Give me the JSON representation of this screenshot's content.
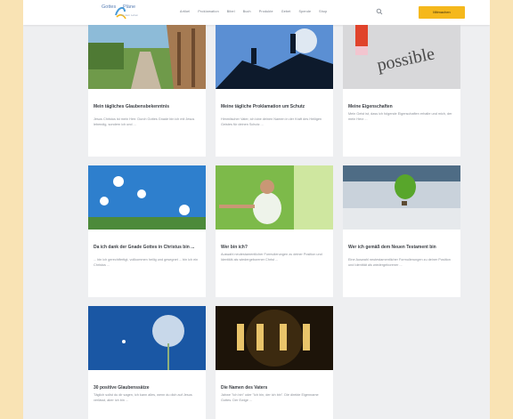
{
  "header": {
    "logo_word1": "Gottes",
    "logo_word2": "Pläne",
    "logo_tagline": "für dein Leben",
    "nav": [
      "Artikel",
      "Proklamation",
      "Bibel",
      "Buch",
      "Produkte",
      "Gebet",
      "Spende",
      "Shop"
    ],
    "cta_label": "Mitmachen",
    "colors": {
      "accent": "#f5b81c",
      "logo": "#5a7fb4"
    }
  },
  "cards": [
    {
      "title": "Mein tägliches Glaubensbekenntnis",
      "excerpt": "Jesus Christus ist mein Herr. Durch Gottes Gnade bin ich mit Jesus lebendig, sondern ich und ..."
    },
    {
      "title": "Meine tägliche Proklamation um Schutz",
      "excerpt": "Himmlischer Vater, ich lobe deinen Namen in der Kraft des Heiligen Geistes für deinen Schutz ..."
    },
    {
      "title": "Meine Eigenschaften",
      "excerpt": "Mein Geist ist, dass ich folgende Eigenschaften erhalte und mich, der mein Herz ..."
    },
    {
      "title": "Da ich dank der Gnade Gottes in Christus bin ...",
      "excerpt": "... bin ich gerechtfertigt, vollkommen heilig und gesegnet ... bin ich ein Christus ..."
    },
    {
      "title": "Wer bin ich?",
      "excerpt": "Auswahl neutestamentlicher Formulierungen zu deiner Position und Identität als wiedergeborener Christ ..."
    },
    {
      "title": "Wer ich gemäß dem Neuen Testament bin",
      "excerpt": "Eine Auswahl neutestamentlicher Formulierungen zu deiner Position und Identität als wiedergeborener ..."
    },
    {
      "title": "30 positive Glaubenssätze",
      "excerpt": "Täglich sollst du dir sagen, ich kann alles, wenn du dich auf Jesus verlässt, aber ich bin ..."
    },
    {
      "title": "Die Namen des Vaters",
      "excerpt": "Jahwe \"Ich bin\" oder \"Ich bin, der ich bin\". Die direkte Eigenname Gottes. Der Ewige ..."
    }
  ],
  "icons": [
    "logo-swirl-icon",
    "search-icon"
  ]
}
